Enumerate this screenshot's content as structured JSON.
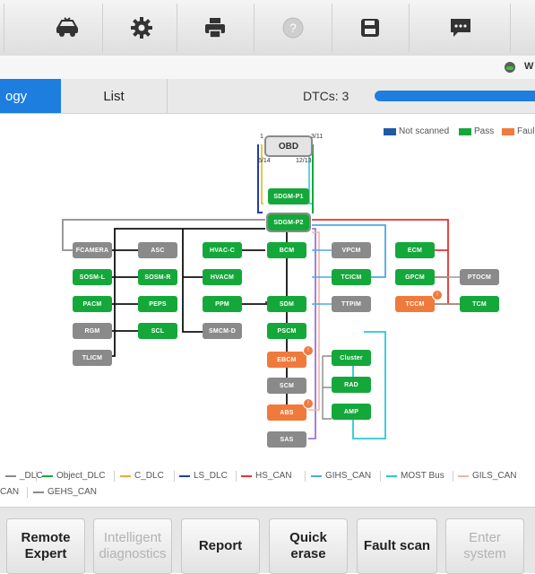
{
  "toolbar": {
    "icons": [
      "car-icon",
      "gear-icon",
      "printer-icon",
      "help-icon",
      "save-icon",
      "chat-icon"
    ]
  },
  "status": {
    "partial_label": "W"
  },
  "tabs": {
    "topology_partial": "ogy",
    "list": "List",
    "dtcs": "DTCs: 3"
  },
  "progress": 1.0,
  "diagram": {
    "legend_status": [
      {
        "label": "Not scanned",
        "color": "#1f5aa6"
      },
      {
        "label": "Pass",
        "color": "#14a83b"
      },
      {
        "label": "Faul",
        "color": "#f07a3c"
      }
    ],
    "obd": {
      "label": "OBD",
      "pins": {
        "p1": "1",
        "p3_11": "3/11",
        "p6_14": "6/14",
        "p12_13": "12/13"
      }
    },
    "ecus": {
      "sdgm_p1": "SDGM-P1",
      "sdgm_p2": "SDGM-P2",
      "fcamera": "FCAMERA",
      "asc": "ASC",
      "sosm_l": "SOSM-L",
      "sosm_r": "SOSM-R",
      "pacm": "PACM",
      "peps": "PEPS",
      "rgm": "RGM",
      "scl": "SCL",
      "tlicm": "TLICM",
      "hvac_c": "HVAC-C",
      "hvacm": "HVACM",
      "ppm": "PPM",
      "smcm_d": "SMCM-D",
      "bcm": "BCM",
      "sdm": "SDM",
      "pscm": "PSCM",
      "ebcm": "EBCM",
      "scm": "SCM",
      "abs": "ABS",
      "sas": "SAS",
      "vpcm": "VPCM",
      "tcicm": "TCICM",
      "ttpim": "TTPIM",
      "cluster": "Cluster",
      "rad": "RAD",
      "amp": "AMP",
      "ecm": "ECM",
      "gpcm": "GPCM",
      "tccm": "TCCM",
      "ptocm": "PTOCM",
      "tcm": "TCM"
    },
    "fault_badge": "!"
  },
  "bus_legend": {
    "row1": [
      {
        "label": "_DLC",
        "color": "#8a8a8a"
      },
      {
        "label": "Object_DLC",
        "color": "#14a83b"
      },
      {
        "label": "C_DLC",
        "color": "#f0a640"
      },
      {
        "label": "LS_DLC",
        "color": "#1f3f9f"
      },
      {
        "label": "HS_CAN",
        "color": "#e53030"
      },
      {
        "label": "GIHS_CAN",
        "color": "#4aa8e8"
      },
      {
        "label": "MOST Bus",
        "color": "#29c9d4"
      },
      {
        "label": "GILS_CAN",
        "color": "#f2b3a8"
      }
    ],
    "row2": [
      {
        "label": "CAN",
        "color": "#ffffff"
      },
      {
        "label": "GEHS_CAN",
        "color": "#8a8a8a"
      }
    ]
  },
  "bottom_buttons": [
    {
      "line1": "Remote",
      "line2": "Expert",
      "enabled": "yes"
    },
    {
      "line1": "Intelligent",
      "line2": "diagnostics",
      "enabled": "no"
    },
    {
      "line1": "Report",
      "line2": "",
      "enabled": "yes"
    },
    {
      "line1": "Quick",
      "line2": "erase",
      "enabled": "yes"
    },
    {
      "line1": "Fault scan",
      "line2": "",
      "enabled": "yes"
    },
    {
      "line1": "Enter",
      "line2": "system",
      "enabled": "no"
    }
  ]
}
